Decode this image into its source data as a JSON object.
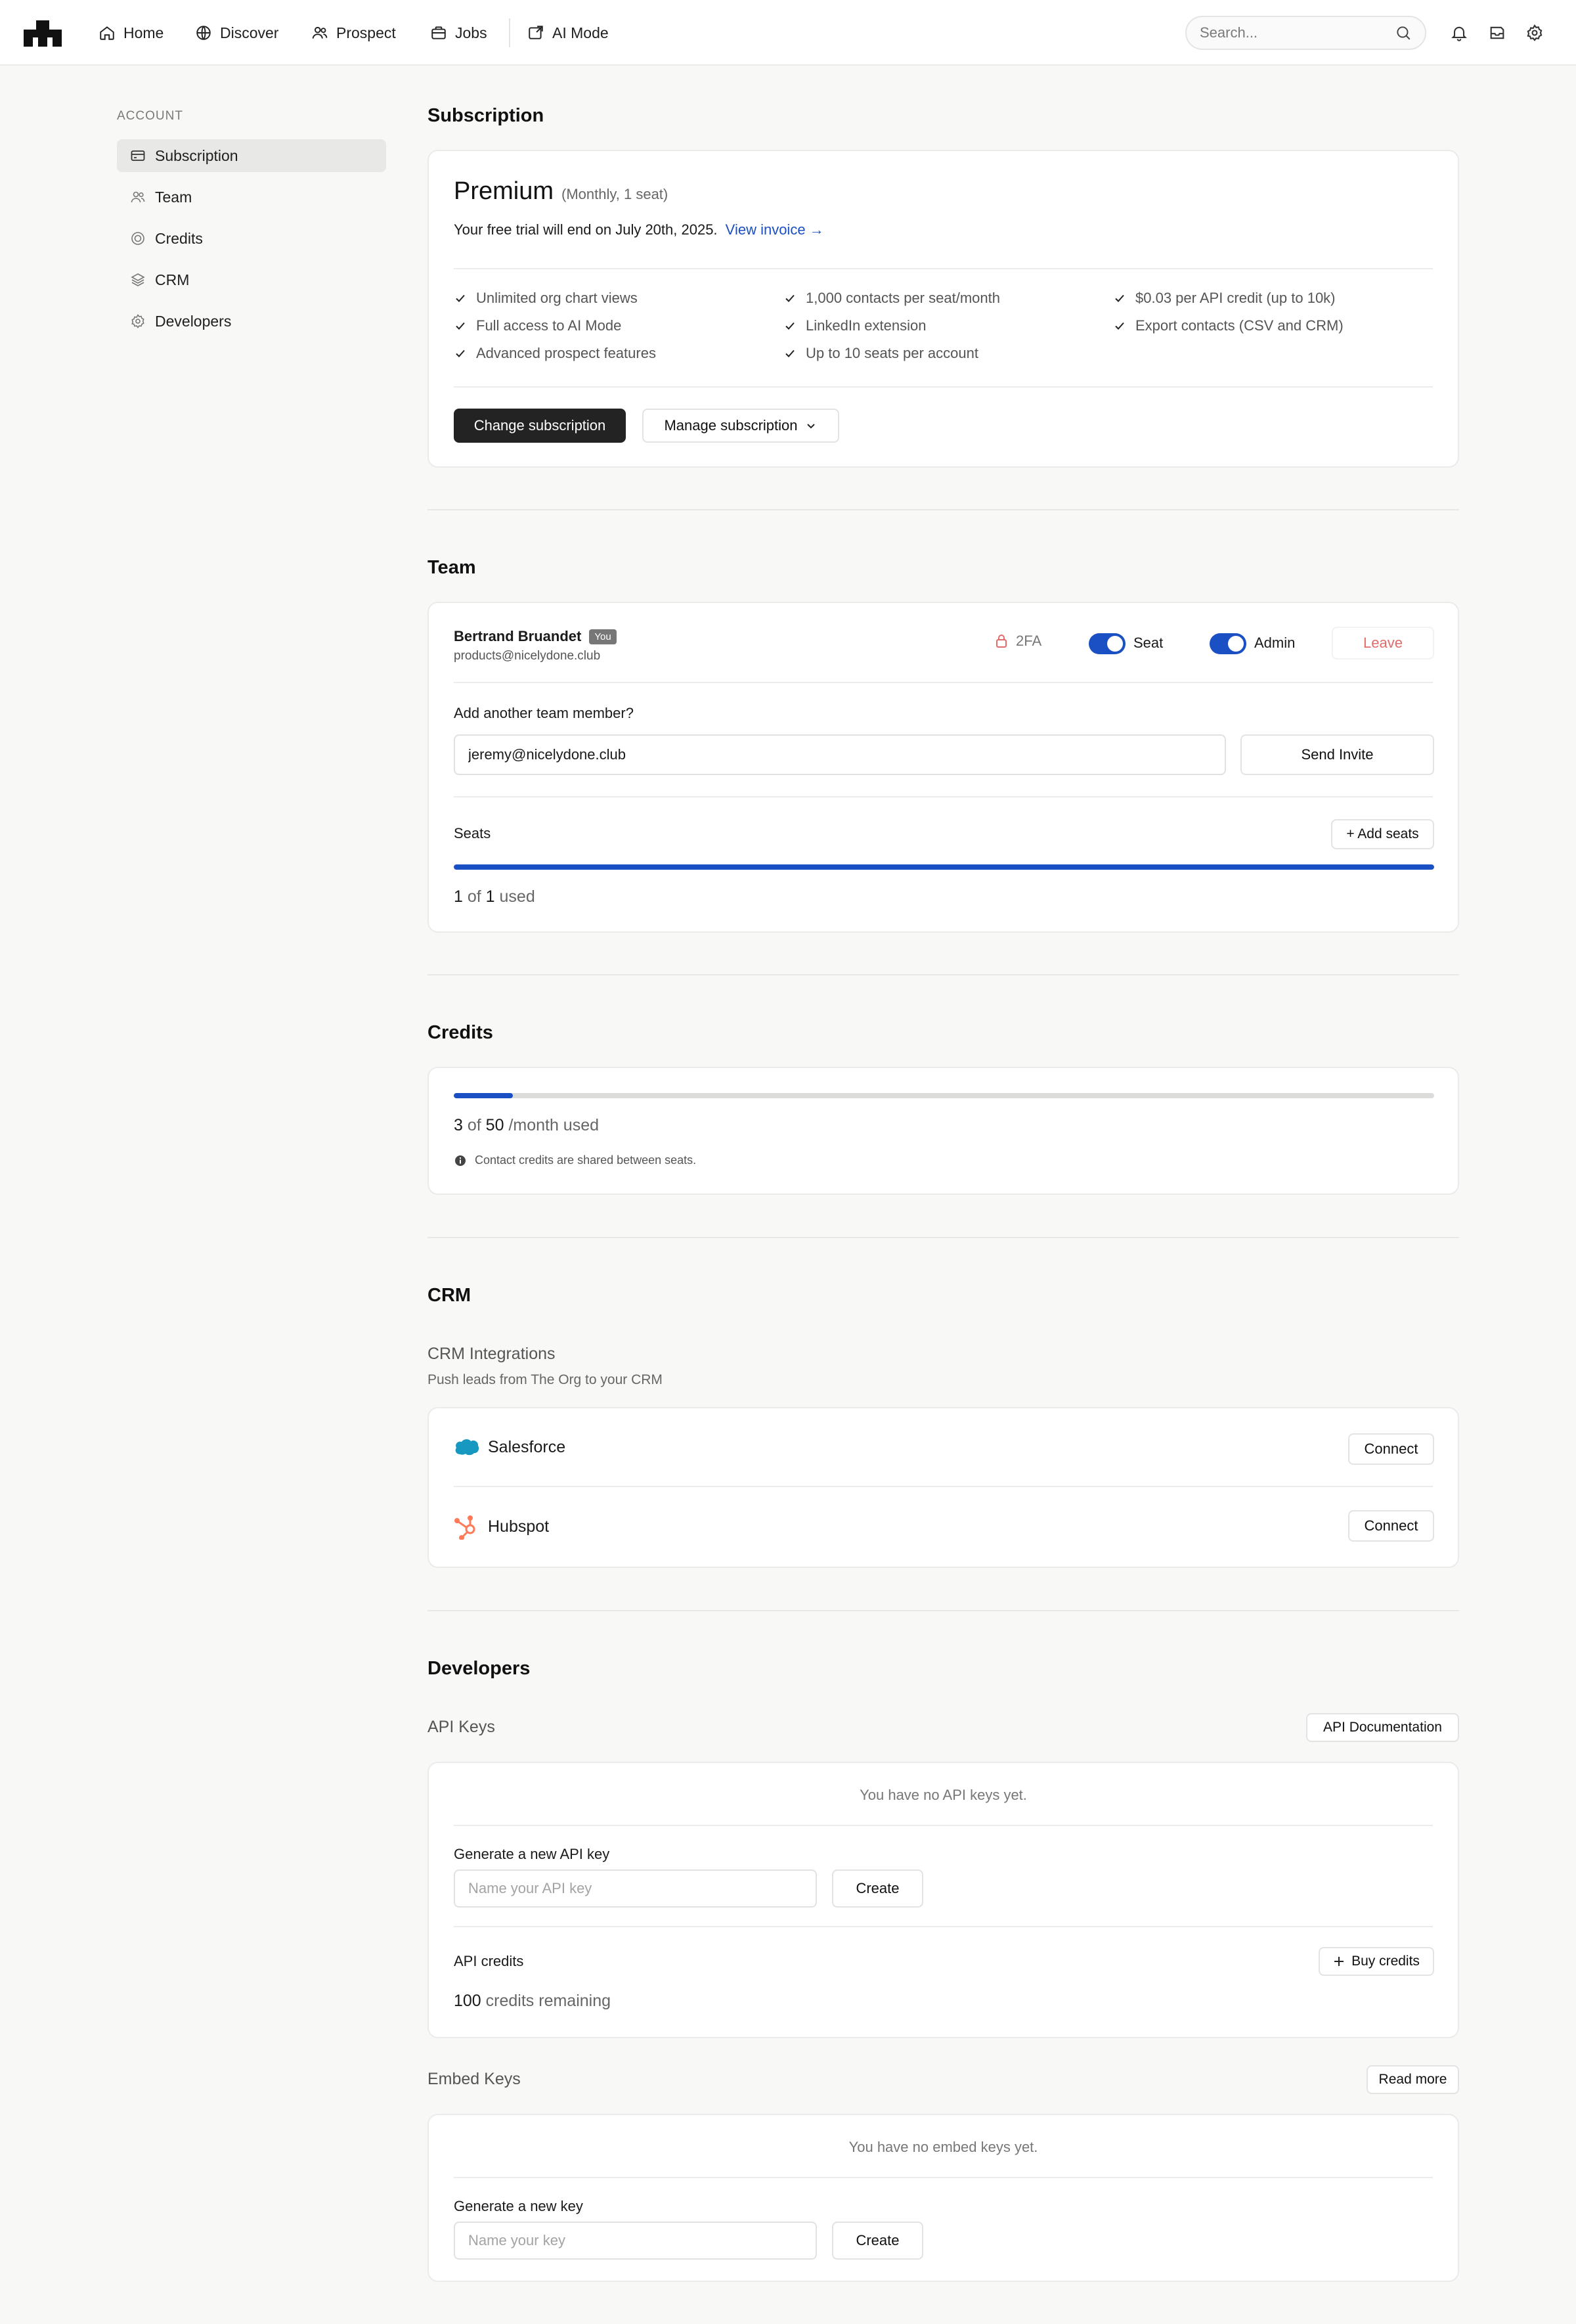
{
  "colors": {
    "accent": "#1b4fc4",
    "dark_button": "#232323",
    "danger": "#e26b6b",
    "salesforce": "#1798c1",
    "hubspot": "#ff7a59"
  },
  "nav": {
    "items": [
      {
        "label": "Home",
        "icon": "home-icon"
      },
      {
        "label": "Discover",
        "icon": "globe-icon"
      },
      {
        "label": "Prospect",
        "icon": "users-icon"
      },
      {
        "label": "Jobs",
        "icon": "briefcase-icon"
      },
      {
        "label": "AI Mode",
        "icon": "ai-mode-icon"
      }
    ],
    "search_placeholder": "Search...",
    "right_icons": [
      "bell-icon",
      "inbox-icon",
      "settings-icon"
    ]
  },
  "sidebar": {
    "heading": "ACCOUNT",
    "items": [
      {
        "label": "Subscription",
        "icon": "card-icon",
        "active": true
      },
      {
        "label": "Team",
        "icon": "users-icon"
      },
      {
        "label": "Credits",
        "icon": "coin-icon"
      },
      {
        "label": "CRM",
        "icon": "layers-icon"
      },
      {
        "label": "Developers",
        "icon": "gear-icon"
      }
    ]
  },
  "subscription": {
    "title": "Subscription",
    "plan": "Premium",
    "plan_detail": "(Monthly, 1 seat)",
    "trial_text": "Your free trial will end on July 20th, 2025.",
    "invoice_link": "View invoice →",
    "features": [
      [
        "Unlimited org chart views",
        "Full access to AI Mode",
        "Advanced prospect features"
      ],
      [
        "1,000 contacts per seat/month",
        "LinkedIn extension",
        "Up to 10 seats per account"
      ],
      [
        "$0.03 per API credit (up to 10k)",
        "Export contacts (CSV and CRM)"
      ]
    ],
    "change_button": "Change subscription",
    "manage_button": "Manage subscription"
  },
  "team": {
    "title": "Team",
    "member": {
      "name": "Bertrand Bruandet",
      "badge": "You",
      "email": "products@nicelydone.club",
      "twofa": "2FA",
      "seat_label": "Seat",
      "seat_on": true,
      "admin_label": "Admin",
      "admin_on": true,
      "leave_label": "Leave"
    },
    "add_label": "Add another team member?",
    "invite_value": "jeremy@nicelydone.club",
    "send_button": "Send Invite",
    "seats_label": "Seats",
    "add_seats_button": "+ Add seats",
    "seats_used": "1",
    "seats_of": "of",
    "seats_total": "1",
    "seats_suffix": "used",
    "seats_fraction": 1.0
  },
  "credits": {
    "title": "Credits",
    "used": "3",
    "of": "of",
    "total": "50",
    "suffix": "/month used",
    "fraction": 0.06,
    "note": "Contact credits are shared between seats."
  },
  "crm": {
    "title": "CRM",
    "subtitle": "CRM Integrations",
    "description": "Push leads from The Org to your CRM",
    "integrations": [
      {
        "name": "Salesforce",
        "icon": "salesforce-icon",
        "button": "Connect"
      },
      {
        "name": "Hubspot",
        "icon": "hubspot-icon",
        "button": "Connect"
      }
    ]
  },
  "developers": {
    "title": "Developers",
    "api_keys_label": "API Keys",
    "api_docs_button": "API Documentation",
    "no_api_keys": "You have no API keys yet.",
    "generate_api_label": "Generate a new API key",
    "api_key_placeholder": "Name your API key",
    "create_button": "Create",
    "api_credits_label": "API credits",
    "buy_credits_button": "Buy credits",
    "credits_remaining_value": "100",
    "credits_remaining_text": "credits remaining",
    "embed_keys_label": "Embed Keys",
    "read_more_button": "Read more",
    "no_embed_keys": "You have no embed keys yet.",
    "generate_embed_label": "Generate a new key",
    "embed_key_placeholder": "Name your key",
    "embed_create_button": "Create"
  }
}
